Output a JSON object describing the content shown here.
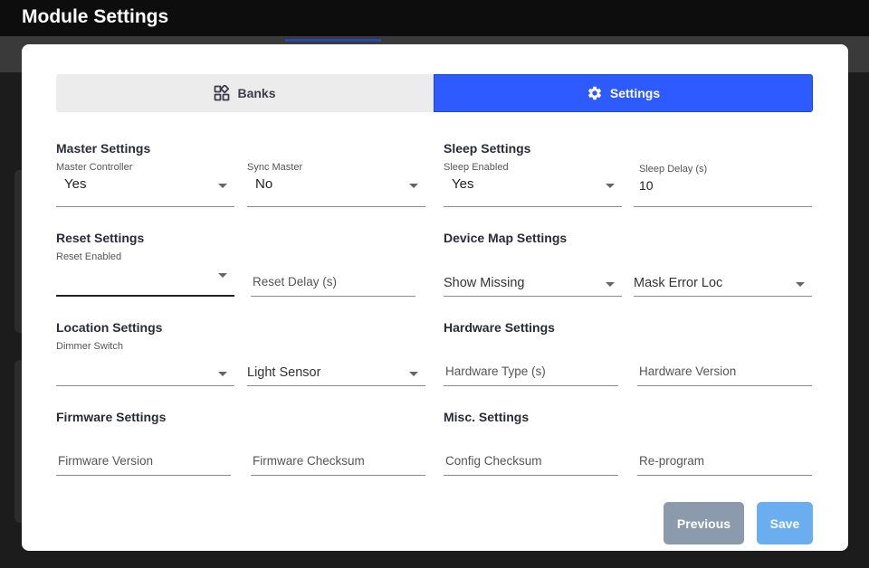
{
  "app": {
    "title": "Module Settings"
  },
  "tabs": {
    "banks": "Banks",
    "settings": "Settings"
  },
  "master": {
    "title": "Master Settings",
    "controller": {
      "label": "Master Controller",
      "value": "Yes"
    },
    "sync": {
      "label": "Sync Master",
      "value": "No"
    }
  },
  "sleep": {
    "title": "Sleep Settings",
    "enabled": {
      "label": "Sleep Enabled",
      "value": "Yes"
    },
    "delay": {
      "label": "Sleep Delay (s)",
      "value": "10"
    }
  },
  "reset": {
    "title": "Reset Settings",
    "enabled": {
      "label": "Reset Enabled",
      "value": ""
    },
    "delay": {
      "label": "Reset Delay (s)"
    }
  },
  "device_map": {
    "title": "Device Map Settings",
    "show_missing": "Show Missing",
    "mask_error_loc": "Mask Error Loc"
  },
  "location": {
    "title": "Location Settings",
    "dimmer": {
      "label": "Dimmer Switch",
      "value": ""
    },
    "light_sensor": "Light Sensor"
  },
  "hardware": {
    "title": "Hardware Settings",
    "type": "Hardware Type (s)",
    "version": "Hardware Version"
  },
  "firmware": {
    "title": "Firmware Settings",
    "version": "Firmware Version",
    "checksum": "Firmware Checksum"
  },
  "misc": {
    "title": "Misc. Settings",
    "config_checksum": "Config Checksum",
    "reprogram": "Re-program"
  },
  "buttons": {
    "previous": "Previous",
    "save": "Save"
  },
  "icons": {
    "banks": "shapes-icon",
    "settings": "gear-icon"
  },
  "colors": {
    "accent": "#2e5bff",
    "previous_button": "#8b9aad",
    "save_button": "#6aaef0"
  }
}
